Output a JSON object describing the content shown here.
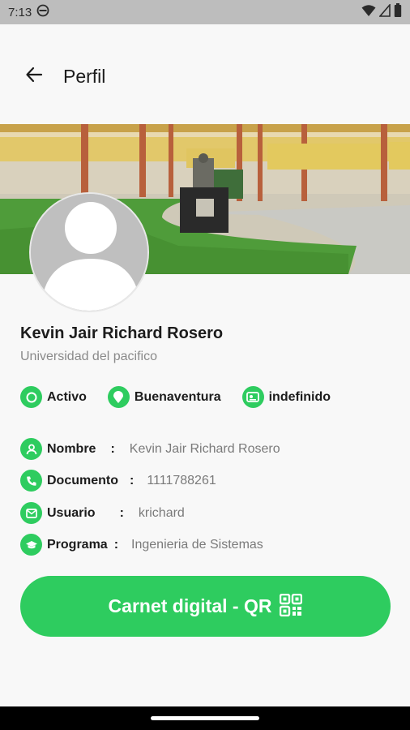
{
  "status_bar": {
    "time": "7:13"
  },
  "app_bar": {
    "title": "Perfil"
  },
  "profile": {
    "name": "Kevin Jair Richard Rosero",
    "university": "Universidad del pacifico"
  },
  "chips": [
    {
      "label": "Activo",
      "icon": "circle-status-icon"
    },
    {
      "label": "Buenaventura",
      "icon": "location-pin-icon"
    },
    {
      "label": "indefinido",
      "icon": "id-card-icon"
    }
  ],
  "info": [
    {
      "key": "Nombre",
      "sep": ":",
      "value": "Kevin Jair Richard Rosero",
      "icon": "person-icon"
    },
    {
      "key": "Documento",
      "sep": ":",
      "value": "1111788261",
      "icon": "phone-icon"
    },
    {
      "key": "Usuario",
      "sep": ":",
      "value": "krichard",
      "icon": "mail-icon"
    },
    {
      "key": "Programa",
      "sep": ":",
      "value": "Ingenieria de Sistemas",
      "icon": "graduation-cap-icon"
    }
  ],
  "qr_button": {
    "label": "Carnet digital - QR",
    "icon": "qr-code-icon"
  },
  "colors": {
    "accent": "#2ecc5f",
    "status_bar": "#bdbdbd",
    "background": "#f8f8f8"
  }
}
